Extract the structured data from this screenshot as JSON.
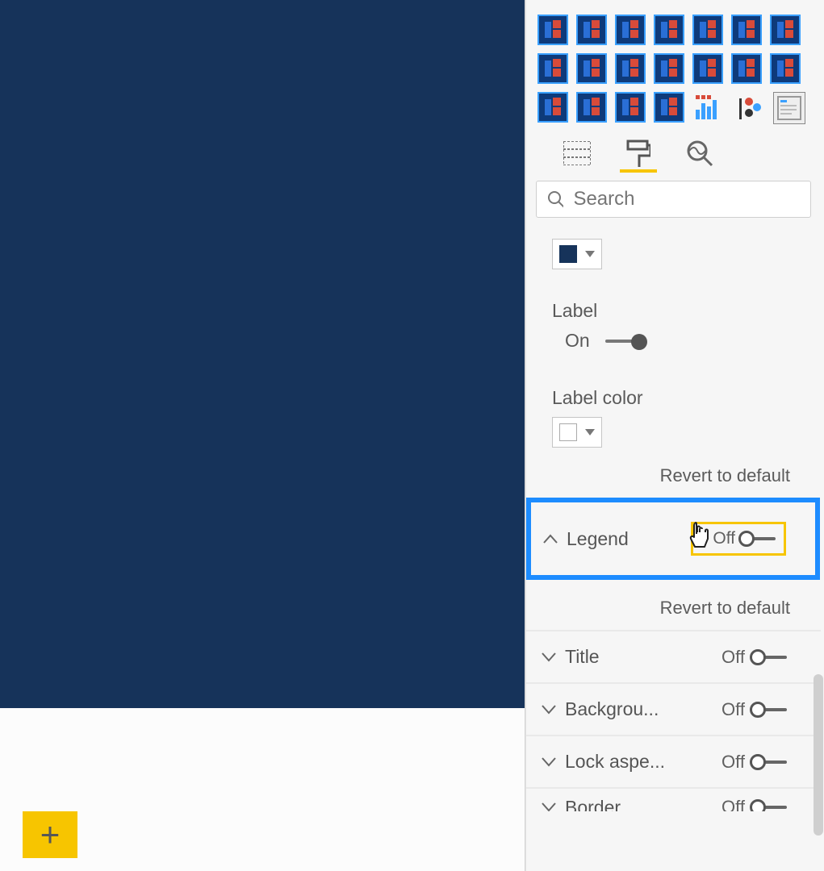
{
  "search": {
    "placeholder": "Search"
  },
  "colors": {
    "dark_swatch": "#16335a",
    "light_swatch": "#ffffff"
  },
  "labels": {
    "label_heading": "Label",
    "label_toggle": "On",
    "label_color_heading": "Label color",
    "revert": "Revert to default"
  },
  "sections": {
    "legend": {
      "title": "Legend",
      "toggle": "Off",
      "expanded": true
    },
    "title": {
      "title": "Title",
      "toggle": "Off"
    },
    "background": {
      "title": "Backgrou...",
      "toggle": "Off"
    },
    "lock_aspect": {
      "title": "Lock aspe...",
      "toggle": "Off"
    },
    "border": {
      "title": "Border",
      "toggle": "Off"
    }
  },
  "icons": {
    "add_page": "+"
  }
}
